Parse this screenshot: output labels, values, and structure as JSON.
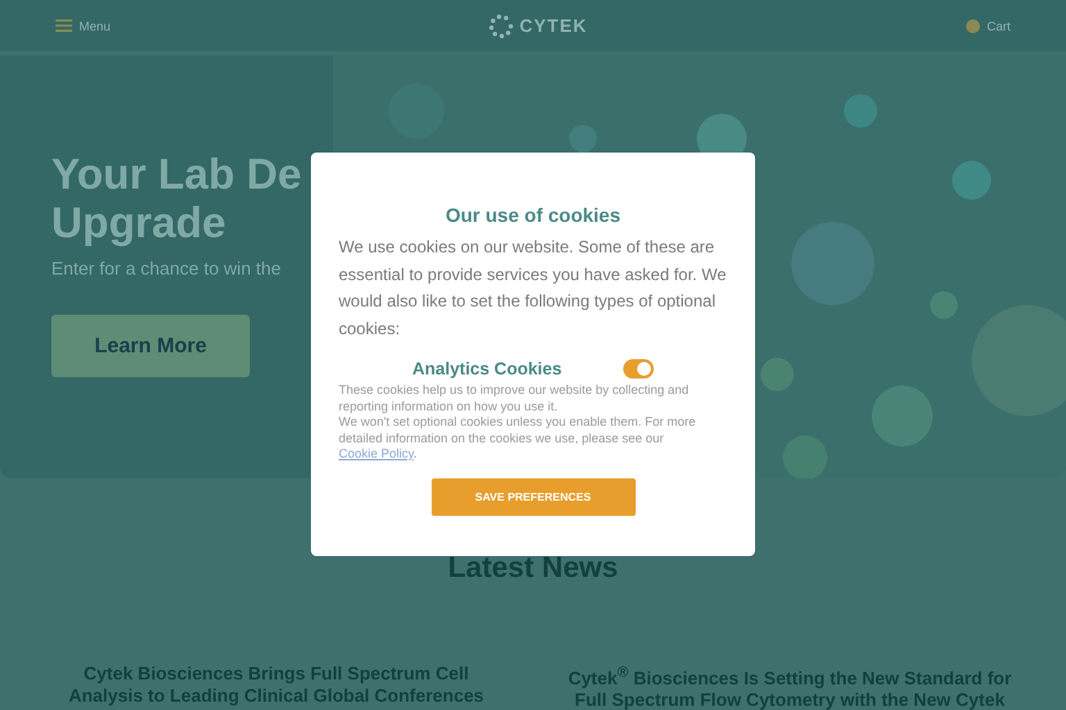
{
  "header": {
    "menu_label": "Menu",
    "logo": "CYTEK",
    "cart_label": "Cart"
  },
  "hero": {
    "title_lines": [
      "Your Lab De",
      "Upgrade"
    ],
    "subtitle": "Enter for a chance to win the",
    "button": "Learn More"
  },
  "news": {
    "heading": "Latest News",
    "articles": [
      {
        "title_lines": [
          "Cytek Biosciences Brings Full Spectrum Cell",
          "Analysis to Leading Clinical Global Conferences"
        ]
      },
      {
        "title_lines": [
          "Cytek$^{®}$ Biosciences Is Setting the New Standard for",
          "Full Spectrum Flow Cytometry with the New Cytek"
        ]
      }
    ]
  },
  "cookie_dialog": {
    "title": "Our use of cookies",
    "intro": "We use cookies on our website. Some of these are essential to provide services you have asked for. We would also like to set the following types of optional cookies:",
    "options": [
      {
        "label": "Analytics Cookies",
        "on": true,
        "description": "These cookies help us to improve our website by collecting and reporting information on how you use it."
      }
    ],
    "notice": "We won't set optional cookies unless you enable them. For more detailed information on the cookies we use, please see our",
    "link": "Cookie Policy",
    "notice_end": ".",
    "button": "SAVE PREFERENCES"
  }
}
